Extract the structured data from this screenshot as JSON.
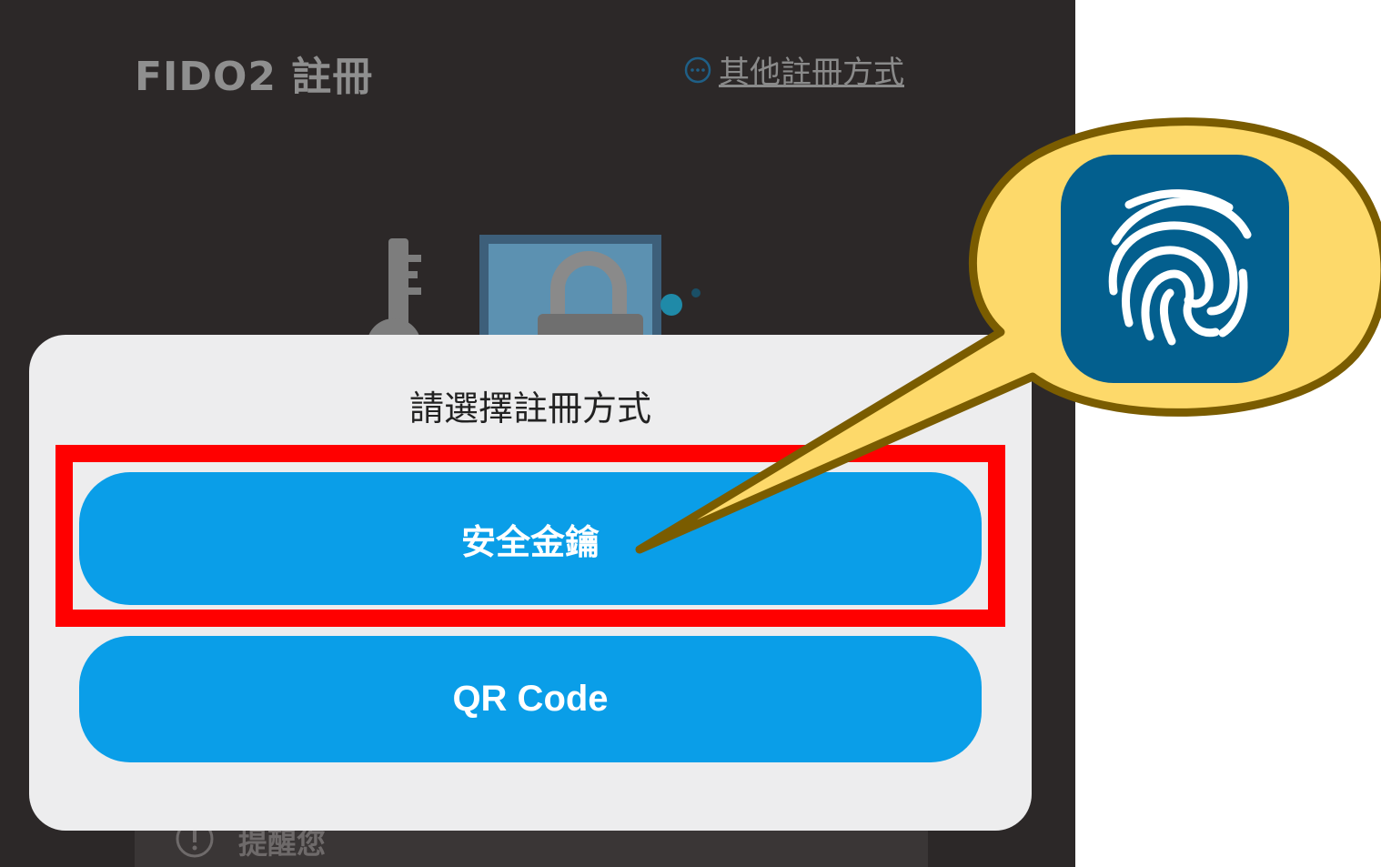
{
  "header": {
    "title": "FIDO2 註冊",
    "other_methods_link": "其他註冊方式",
    "other_methods_icon": "more-horizontal-circle-icon"
  },
  "reminder": {
    "icon": "exclamation-circle-icon",
    "label": "提醒您"
  },
  "modal": {
    "title": "請選擇註冊方式",
    "security_key_button": "安全金鑰",
    "qr_code_button": "QR Code"
  },
  "annotation": {
    "highlight_color": "#ff0000",
    "callout_fill": "#fdd96a",
    "callout_border": "#7a5c00",
    "callout_icon": "fingerprint-icon",
    "callout_icon_bg": "#035f8e"
  },
  "colors": {
    "app_background": "#2c2828",
    "modal_background": "#ededee",
    "button_color": "#0a9ee8"
  }
}
